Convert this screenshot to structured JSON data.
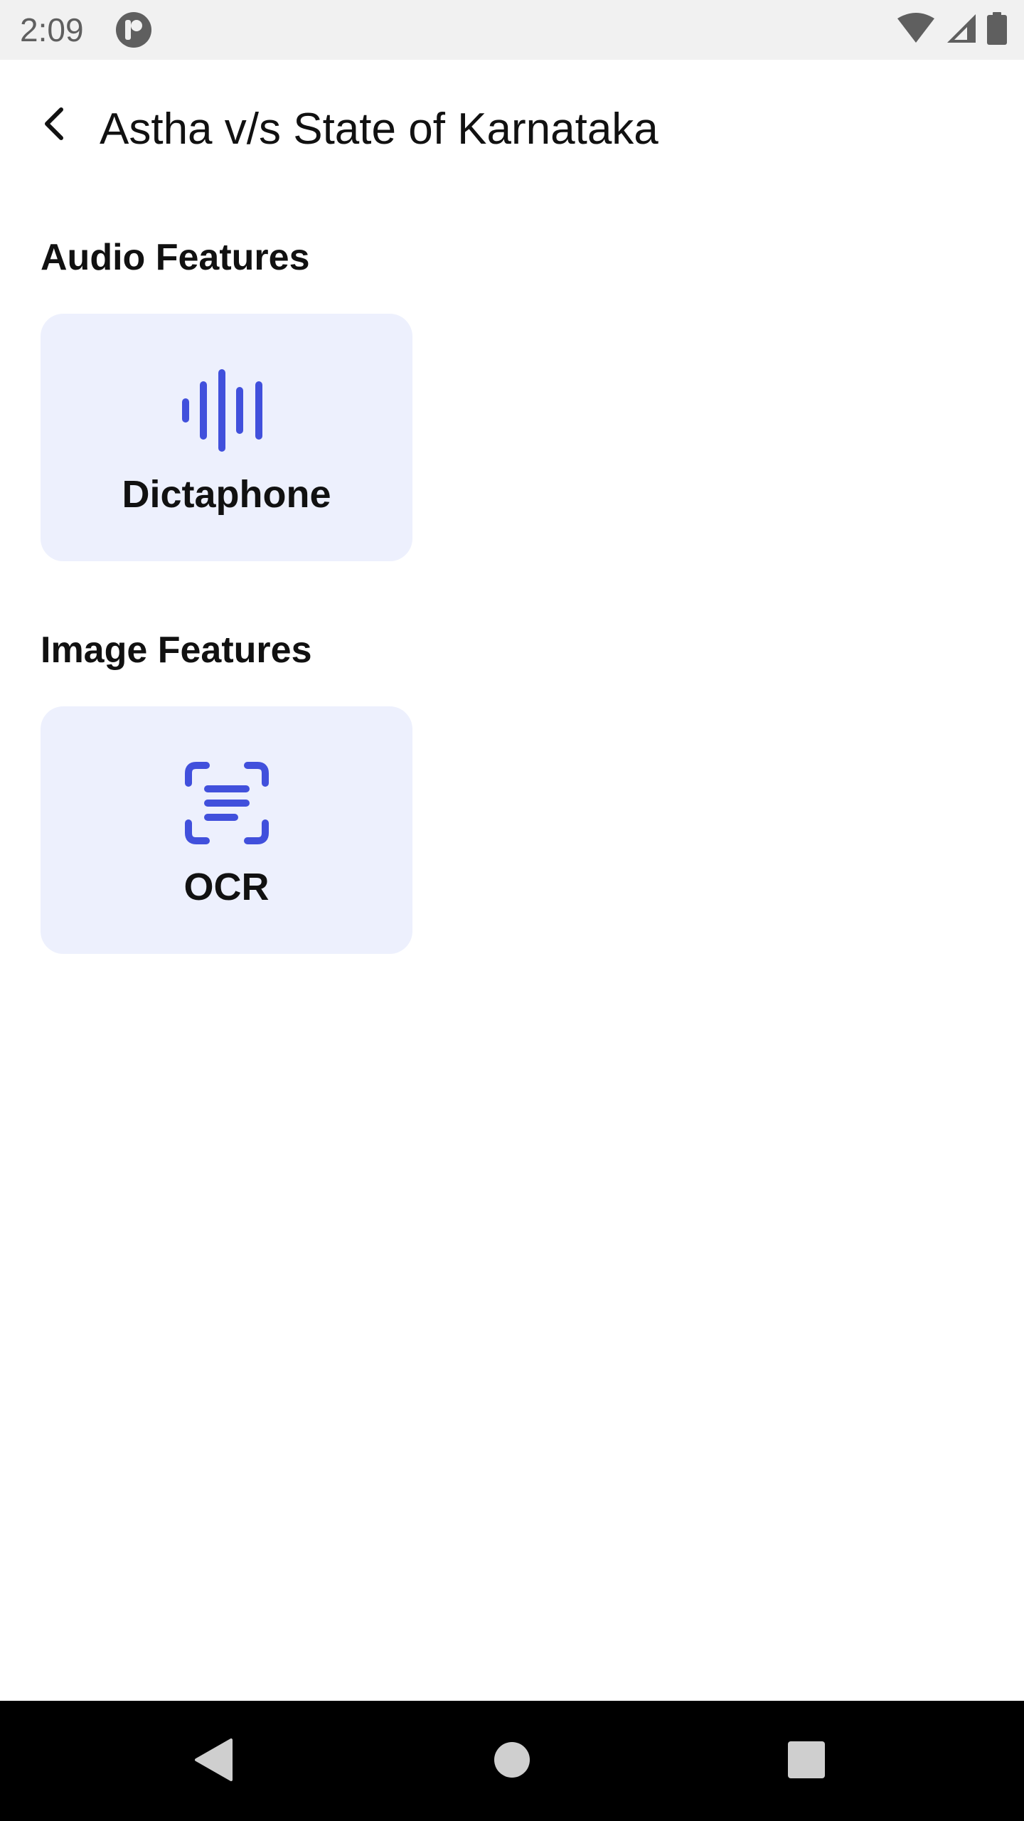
{
  "status_bar": {
    "time": "2:09",
    "icons": [
      "app-notification-icon",
      "wifi-icon",
      "cellular-signal-icon",
      "battery-icon"
    ]
  },
  "app_bar": {
    "back_icon": "chevron-left-icon",
    "title": "Astha v/s State of Karnataka"
  },
  "sections": {
    "audio": {
      "heading": "Audio Features",
      "feature": {
        "label": "Dictaphone",
        "icon": "sound-wave-icon"
      }
    },
    "image": {
      "heading": "Image Features",
      "feature": {
        "label": "OCR",
        "icon": "document-scan-icon"
      }
    }
  },
  "nav_bar": {
    "icons": [
      "back-triangle-icon",
      "home-circle-icon",
      "recents-square-icon"
    ]
  },
  "colors": {
    "accent": "#4150dc",
    "card_background": "#edf0fd",
    "status_bar_background": "#f1f1f1",
    "nav_bar_background": "#000000"
  }
}
